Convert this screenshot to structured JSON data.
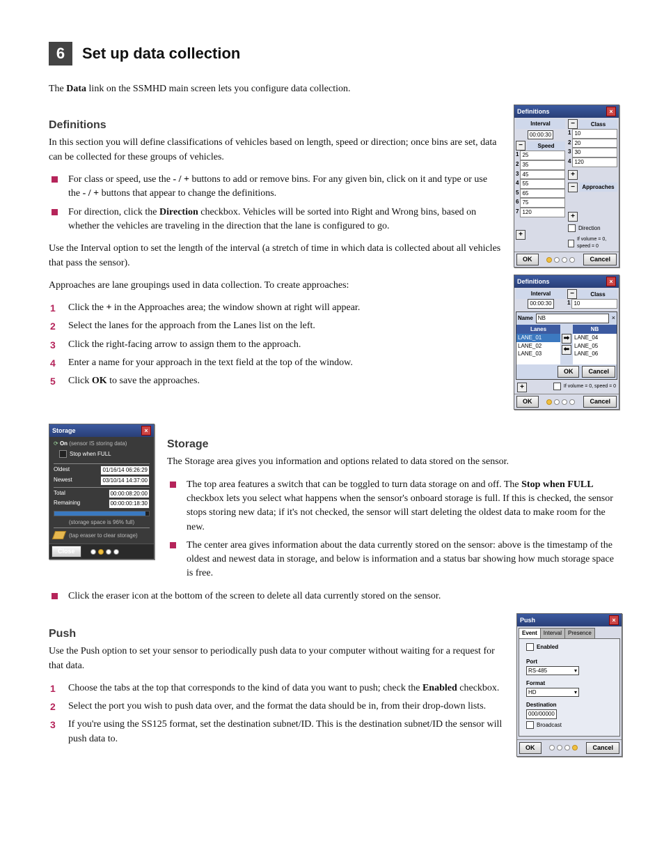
{
  "section": {
    "number": "6",
    "title": "Set up data collection"
  },
  "intro": {
    "pre": "The ",
    "bold": "Data",
    "post": " link on the SSMHD main screen lets you configure data collection."
  },
  "definitions": {
    "heading": "Definitions",
    "intro": "In this section you will define classifications of vehicles based on length, speed or direction; once bins are set, data can be collected for these groups of vehicles.",
    "b1_a": "For class or speed, use the ",
    "b1_b": " buttons to add or remove bins. For any given bin, click on it and type or use the ",
    "b1_c": " buttons that appear to change the definitions.",
    "minus_plus": "- / +",
    "b2_a": "For direction, click the ",
    "b2_dir": "Direction",
    "b2_b": " checkbox. Vehicles will be sorted into Right and Wrong bins, based on whether the vehicles are traveling in the direction that the lane is configured to go.",
    "para2": "Use the Interval option to set the length of the interval (a stretch of time in which data is collected about all vehicles that pass the sensor).",
    "para3": "Approaches are lane groupings used in data collection. To create approaches:",
    "s1_a": "Click the ",
    "s1_plus": "+",
    "s1_b": " in the Approaches area; the window shown at right will appear.",
    "s2": "Select the lanes for the approach from the Lanes list on the left.",
    "s3": "Click the right-facing arrow to assign them to the approach.",
    "s4": "Enter a name for your approach in the text field at the top of the window.",
    "s5_a": "Click ",
    "s5_ok": "OK",
    "s5_b": " to save the approaches."
  },
  "storage": {
    "heading": "Storage",
    "intro": "The Storage area gives you information and options related to data stored on the sensor.",
    "b1_a": "The top area features a switch that can be toggled to turn data storage on and off. The ",
    "b1_bold": "Stop when FULL",
    "b1_b": " checkbox lets you select what happens when the sensor's onboard storage is full. If this is checked, the sensor stops storing new data; if it's not checked, the sensor will start deleting the oldest data to make room for the new.",
    "b2": "The center area gives information about the data currently stored on the sensor: above is the timestamp of the oldest and newest data in storage, and below is information and a status bar showing how much storage space is free.",
    "b3": "Click the eraser icon at the bottom of the screen to delete all data currently stored on the sensor."
  },
  "push": {
    "heading": "Push",
    "intro": "Use the Push option to set your sensor to periodically push data to your computer without waiting for a request for that data.",
    "s1_a": "Choose the tabs at the top that corresponds to the kind of data you want to push; check the ",
    "s1_bold": "Enabled",
    "s1_b": " checkbox.",
    "s2": "Select the port you wish to push data over, and the format the data should be in, from their drop-down lists.",
    "s3": "If you're using the SS125 format, set the destination subnet/ID. This is the destination subnet/ID the sensor will push data to."
  },
  "fig_def": {
    "title": "Definitions",
    "interval_label": "Interval",
    "interval": "00:00:30",
    "speed_label": "Speed",
    "speed_bins": [
      "25",
      "35",
      "45",
      "55",
      "65",
      "75",
      "120"
    ],
    "class_label": "Class",
    "class_bins": [
      "10",
      "20",
      "30",
      "120"
    ],
    "approaches_label": "Approaches",
    "direction_label": "Direction",
    "ifvol": "If volume = 0, speed = 0",
    "ok": "OK",
    "cancel": "Cancel"
  },
  "fig_def2": {
    "title": "Definitions",
    "interval_label": "Interval",
    "interval": "00:00:30",
    "class_label": "Class",
    "class_val": "10",
    "name_label": "Name",
    "name_val": "NB",
    "lanes_label": "Lanes",
    "nb_label": "NB",
    "left_lanes": [
      "LANE_01",
      "LANE_02",
      "LANE_03"
    ],
    "right_lanes": [
      "LANE_04",
      "LANE_05",
      "LANE_06"
    ],
    "ok": "OK",
    "cancel": "Cancel",
    "ifvol": "If volume = 0, speed = 0"
  },
  "fig_storage": {
    "title": "Storage",
    "on": "On",
    "on_note": "(sensor IS storing data)",
    "stop_full": "Stop when FULL",
    "oldest_l": "Oldest",
    "oldest_v": "01/16/14 06:26:29",
    "newest_l": "Newest",
    "newest_v": "03/10/14 14:37:00",
    "total_l": "Total",
    "total_v": "00:00:08:20:00",
    "remain_l": "Remaining",
    "remain_v": "00:00:00:18:30",
    "pct": "(storage space is 96% full)",
    "tap": "(tap eraser to clear storage)",
    "close": "Close"
  },
  "fig_push": {
    "title": "Push",
    "tabs": [
      "Event",
      "Interval",
      "Presence"
    ],
    "enabled": "Enabled",
    "port_l": "Port",
    "port_v": "RS-485",
    "format_l": "Format",
    "format_v": "HD",
    "dest_l": "Destination",
    "dest_v": "000/00000",
    "broadcast": "Broadcast",
    "ok": "OK",
    "cancel": "Cancel"
  }
}
